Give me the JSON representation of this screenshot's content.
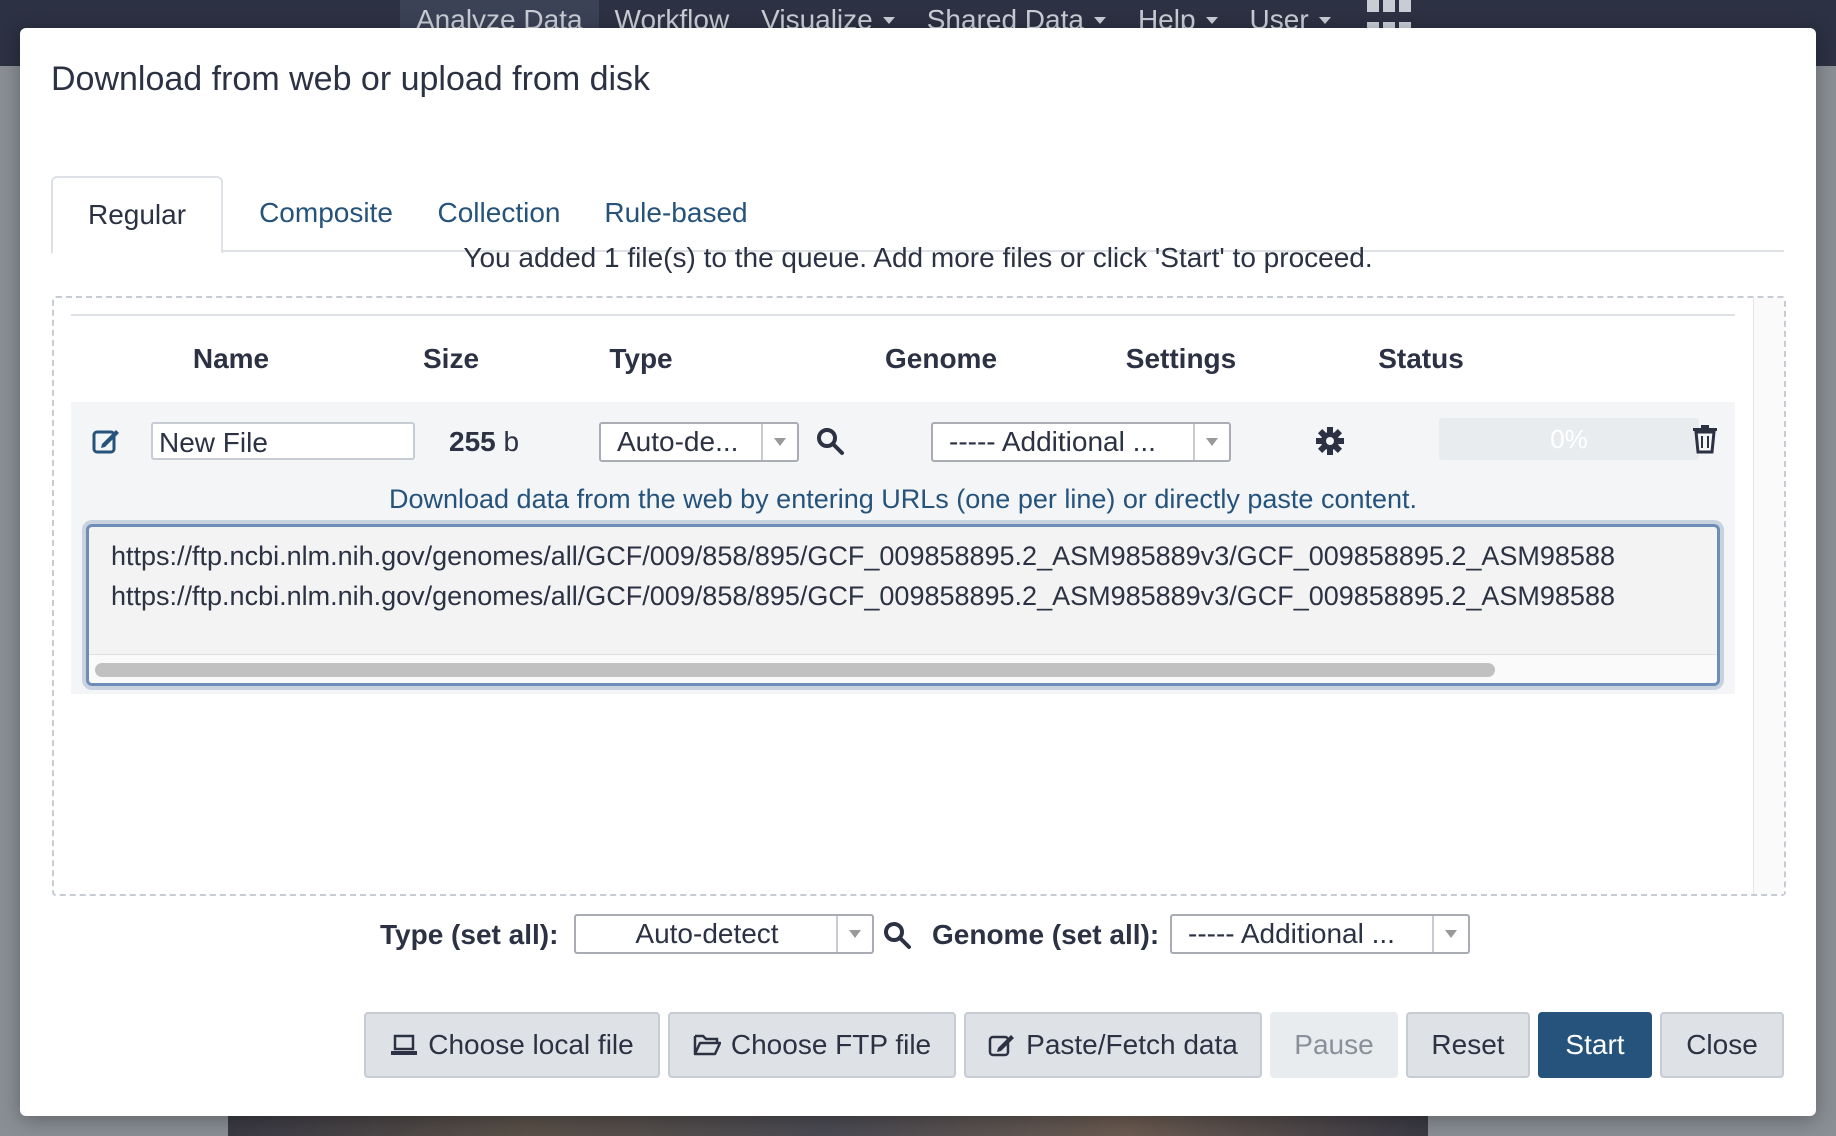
{
  "topnav": {
    "items": [
      {
        "label": "Analyze Data",
        "dropdown": false
      },
      {
        "label": "Workflow",
        "dropdown": false
      },
      {
        "label": "Visualize",
        "dropdown": true
      },
      {
        "label": "Shared Data",
        "dropdown": true
      },
      {
        "label": "Help",
        "dropdown": true
      },
      {
        "label": "User",
        "dropdown": true
      }
    ],
    "apps_icon": "grid-icon"
  },
  "modal": {
    "title": "Download from web or upload from disk",
    "tabs": [
      {
        "label": "Regular",
        "active": true
      },
      {
        "label": "Composite",
        "active": false
      },
      {
        "label": "Collection",
        "active": false
      },
      {
        "label": "Rule-based",
        "active": false
      }
    ],
    "queue_message": "You added 1 file(s) to the queue. Add more files or click 'Start' to proceed.",
    "table": {
      "headers": [
        "Name",
        "Size",
        "Type",
        "Genome",
        "Settings",
        "Status"
      ]
    },
    "file_row": {
      "name": "New File",
      "size_value": "255",
      "size_unit": "b",
      "type": "Auto-de...",
      "genome": "----- Additional ...",
      "progress": "0%",
      "url_hint": "Download data from the web by entering URLs (one per line) or directly paste content.",
      "urls": [
        "https://ftp.ncbi.nlm.nih.gov/genomes/all/GCF/009/858/895/GCF_009858895.2_ASM985889v3/GCF_009858895.2_ASM98588",
        "https://ftp.ncbi.nlm.nih.gov/genomes/all/GCF/009/858/895/GCF_009858895.2_ASM985889v3/GCF_009858895.2_ASM98588"
      ]
    },
    "set_all": {
      "type_label": "Type (set all):",
      "type_value": "Auto-detect",
      "genome_label": "Genome (set all):",
      "genome_value": "----- Additional ..."
    },
    "buttons": {
      "choose_local": "Choose local file",
      "choose_ftp": "Choose FTP file",
      "paste_fetch": "Paste/Fetch data",
      "pause": "Pause",
      "reset": "Reset",
      "start": "Start",
      "close": "Close"
    },
    "colors": {
      "primary": "#25537b",
      "navbar": "#2c3143",
      "link": "#25537b"
    }
  }
}
